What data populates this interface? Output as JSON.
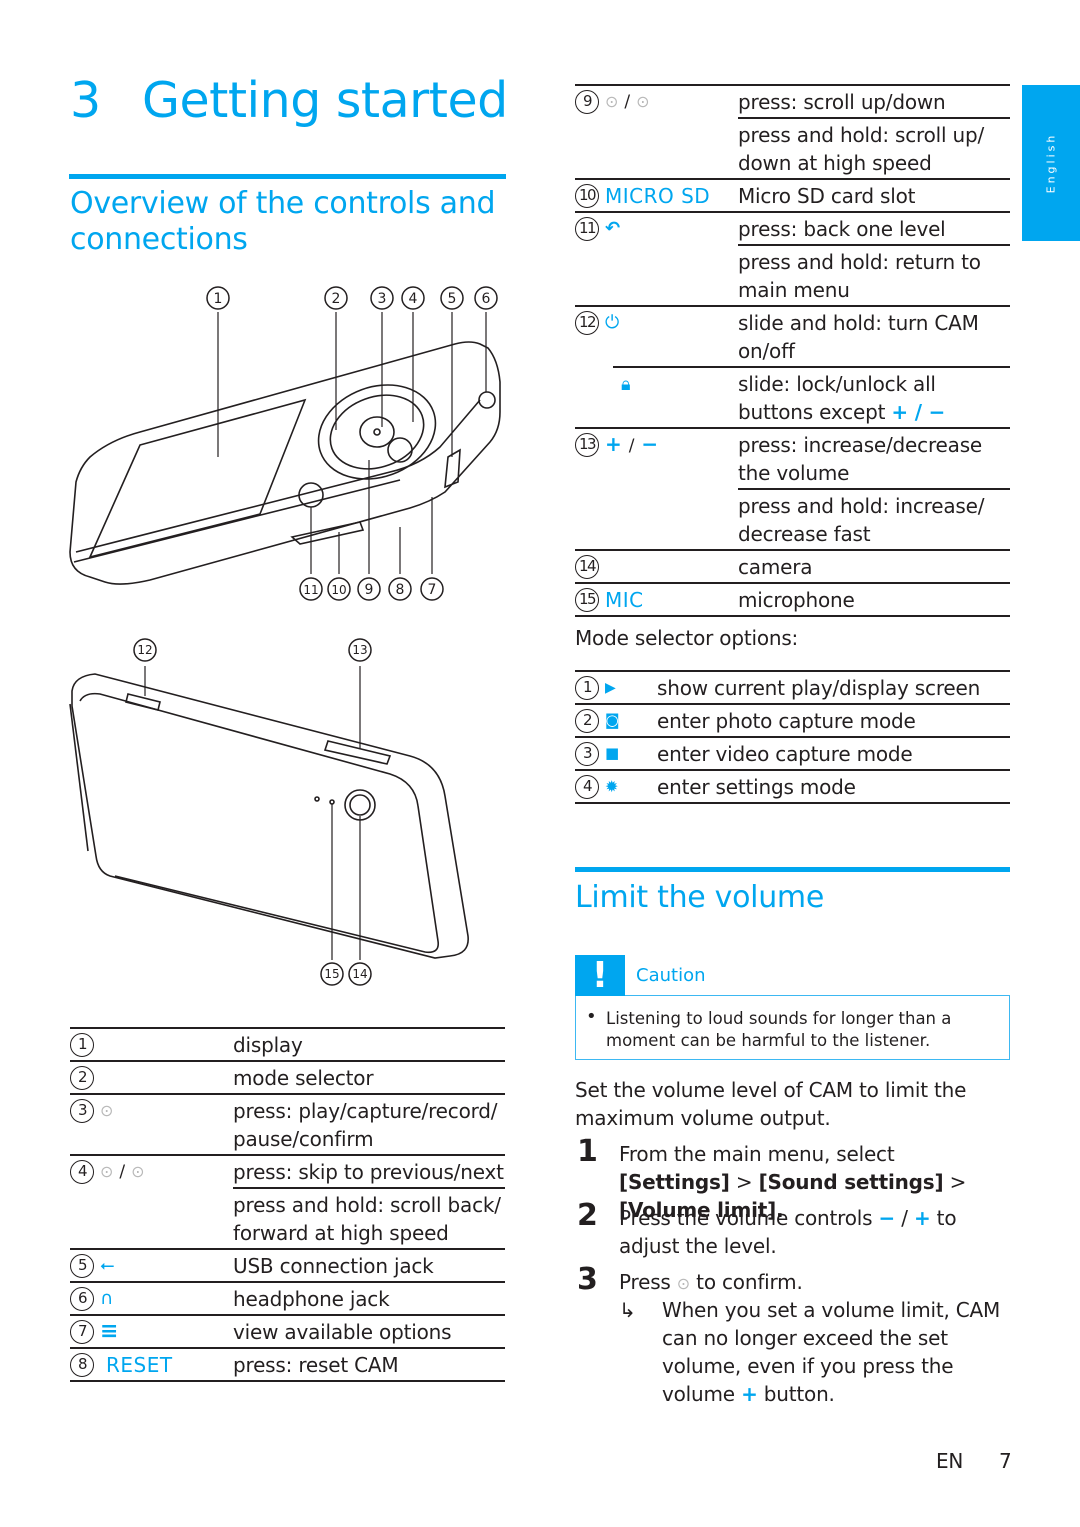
{
  "chapter": {
    "number": "3",
    "title": "Getting started"
  },
  "overview": {
    "title_line1": "Overview of the controls and",
    "title_line2": "connections"
  },
  "diagram_front": {
    "callouts_top": [
      "1",
      "2",
      "3",
      "4",
      "5",
      "6"
    ],
    "callouts_bottom": [
      "11",
      "10",
      "9",
      "8",
      "7"
    ]
  },
  "diagram_back": {
    "callouts_top": [
      "12",
      "13"
    ],
    "callouts_bottom": [
      "15",
      "14"
    ]
  },
  "left_table": [
    {
      "num": "1",
      "icon": "",
      "keyword": "",
      "lines": [
        "display"
      ]
    },
    {
      "num": "2",
      "icon": "",
      "keyword": "",
      "lines": [
        "mode selector"
      ]
    },
    {
      "num": "3",
      "icon": "navigation-center-icon",
      "keyword": "",
      "lines": [
        "press: play/capture/record/ pause/confirm"
      ]
    },
    {
      "num": "4",
      "icon": "navigation-left-right-icon",
      "keyword": "",
      "lines": [
        "press: skip to previous/next",
        "press and hold: scroll back/ forward at high speed"
      ]
    },
    {
      "num": "5",
      "icon": "usb-icon",
      "keyword": "",
      "lines": [
        "USB connection jack"
      ]
    },
    {
      "num": "6",
      "icon": "headphone-icon",
      "keyword": "",
      "lines": [
        "headphone jack"
      ]
    },
    {
      "num": "7",
      "icon": "options-menu-icon",
      "keyword": "",
      "lines": [
        "view available options"
      ]
    },
    {
      "num": "8",
      "icon": "",
      "keyword": "RESET",
      "lines": [
        "press: reset CAM"
      ]
    }
  ],
  "right_table": [
    {
      "num": "9",
      "icon": "navigation-up-down-icon",
      "keyword": "",
      "lines": [
        "press: scroll up/down",
        "press and hold: scroll up/ down at high speed"
      ]
    },
    {
      "num": "10",
      "icon": "",
      "keyword": "MICRO SD",
      "lines": [
        "Micro SD card slot"
      ]
    },
    {
      "num": "11",
      "icon": "back-icon",
      "keyword": "",
      "lines": [
        "press: back one level",
        "press and hold: return to main menu"
      ]
    },
    {
      "num": "12",
      "icon": "power-icon",
      "keyword": "",
      "lines": [
        "slide and hold: turn CAM on/off"
      ],
      "sub": {
        "icon": "lock-icon",
        "line": "slide: lock/unlock all buttons except",
        "suffix": "+ / −"
      }
    },
    {
      "num": "13",
      "icon": "volume-plus-minus-icon",
      "keyword": "",
      "lines": [
        "press: increase/decrease the volume",
        "press and hold: increase/ decrease fast"
      ]
    },
    {
      "num": "14",
      "icon": "",
      "keyword": "",
      "lines": [
        "camera"
      ]
    },
    {
      "num": "15",
      "icon": "",
      "keyword": "MIC",
      "lines": [
        "microphone"
      ]
    }
  ],
  "mode_selector": {
    "intro": "Mode selector options:",
    "options": [
      {
        "num": "1",
        "icon": "play-icon",
        "text": "show current play/display screen"
      },
      {
        "num": "2",
        "icon": "photo-camera-icon",
        "text": "enter photo capture mode"
      },
      {
        "num": "3",
        "icon": "video-camera-icon",
        "text": "enter video capture mode"
      },
      {
        "num": "4",
        "icon": "settings-gear-icon",
        "text": "enter settings mode"
      }
    ]
  },
  "limit_volume": {
    "title": "Limit the volume",
    "caution": {
      "label": "Caution",
      "icon": "!",
      "text": "Listening to loud sounds for longer than a moment can be harmful to the listener."
    },
    "intro": "Set the volume level of CAM to limit the maximum volume output.",
    "steps": [
      {
        "num": "1",
        "parts": {
          "a": "From the main menu, select ",
          "b1": "[Settings]",
          "c": " > ",
          "b2": "[Sound settings]",
          "d": " > ",
          "b3": "[Volume limit]."
        }
      },
      {
        "num": "2",
        "parts": {
          "a": "Press the volume controls ",
          "minus": "−",
          "slash": " / ",
          "plus": "+",
          "b": " to adjust the level."
        }
      },
      {
        "num": "3",
        "parts": {
          "a": "Press ",
          "b": " to confirm."
        },
        "result": {
          "arrow": "↳",
          "text_a": "When you set a volume limit, CAM can no longer exceed the set volume, even if you press the volume ",
          "plus": "+",
          "text_b": " button."
        }
      }
    ]
  },
  "side_tab": {
    "label": "English"
  },
  "footer": {
    "lang": "EN",
    "page": "7"
  },
  "colors": {
    "accent": "#00a6ef",
    "text": "#231f20"
  }
}
